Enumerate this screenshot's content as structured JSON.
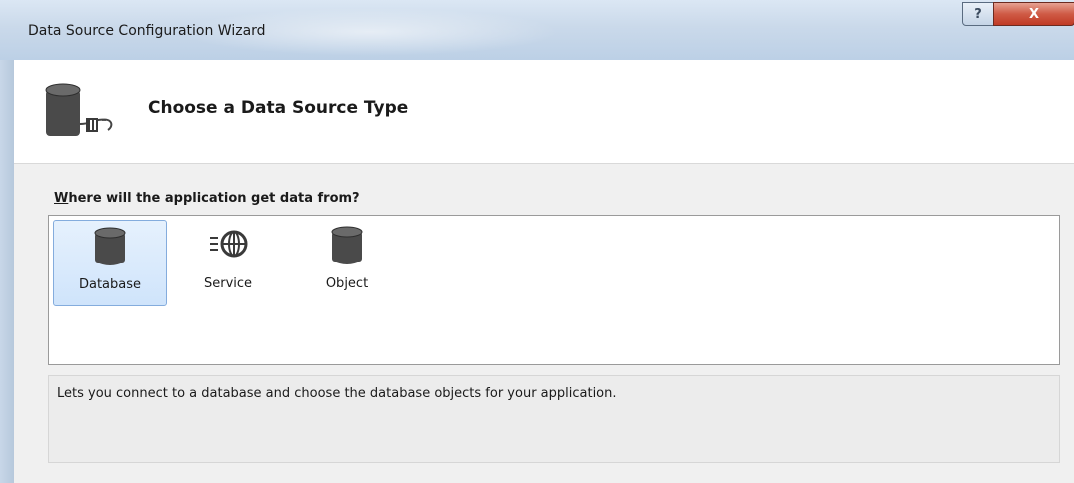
{
  "window": {
    "title": "Data Source Configuration Wizard",
    "help_label": "?",
    "close_label": "X"
  },
  "header": {
    "title": "Choose a Data Source Type",
    "icon": "database-connect-icon"
  },
  "prompt": {
    "accelerator": "W",
    "rest": "here will the application get data from?"
  },
  "data_sources": {
    "selected": "Database",
    "items": [
      {
        "label": "Database",
        "icon": "database-icon"
      },
      {
        "label": "Service",
        "icon": "service-globe-icon"
      },
      {
        "label": "Object",
        "icon": "object-icon"
      }
    ]
  },
  "description": "Lets you connect to a database and choose the database objects for your application."
}
